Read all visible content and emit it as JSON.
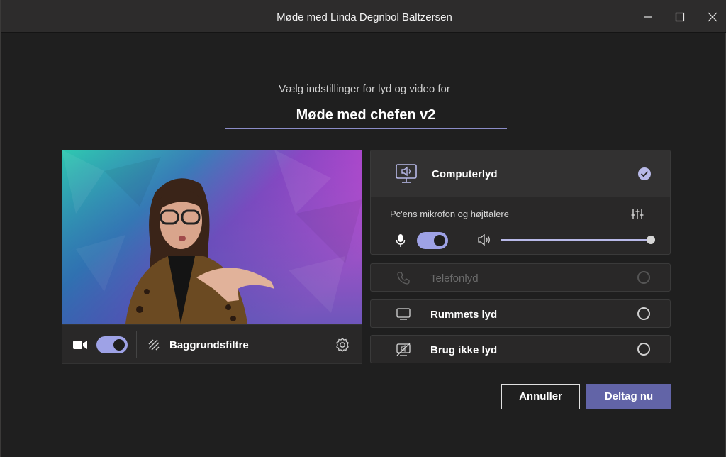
{
  "window": {
    "title": "Møde med Linda Degnbol Baltzersen"
  },
  "prejoin": {
    "subtitle": "Vælg indstillinger for lyd og video for",
    "meeting_name": "Møde med chefen v2"
  },
  "video_controls": {
    "camera_on": true,
    "background_filters_label": "Baggrundsfiltre"
  },
  "audio": {
    "computer": {
      "label": "Computerlyd",
      "selected": true,
      "device_label": "Pc'ens mikrofon og højttalere",
      "mic_on": true,
      "speaker_volume": 1.0
    },
    "phone": {
      "label": "Telefonlyd",
      "enabled": false
    },
    "room": {
      "label": "Rummets lyd"
    },
    "no_audio": {
      "label": "Brug ikke lyd"
    }
  },
  "actions": {
    "cancel_label": "Annuller",
    "join_label": "Deltag nu"
  },
  "colors": {
    "accent": "#6264a7",
    "toggle": "#9ea2e6",
    "background": "#1f1f1f",
    "panel": "#292828"
  }
}
